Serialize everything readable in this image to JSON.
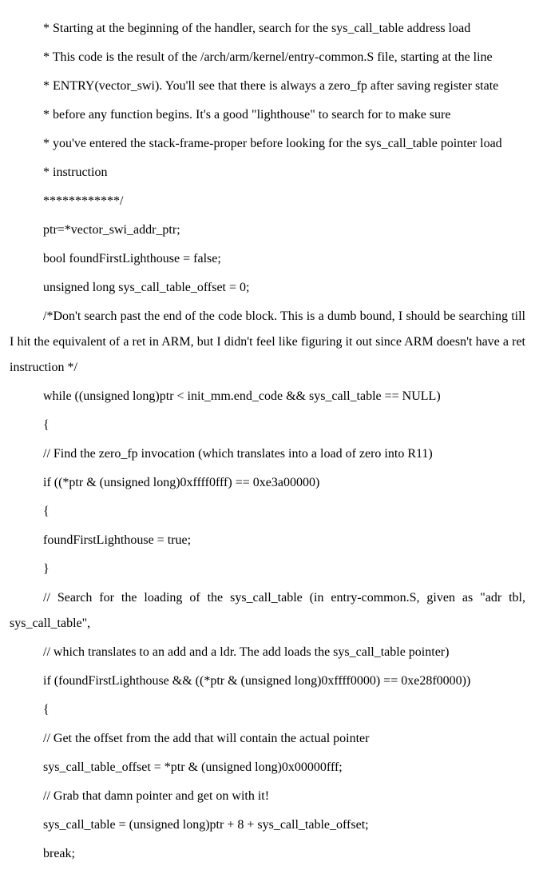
{
  "lines": {
    "l1": "* Starting at the beginning of the handler, search for the sys_call_table address load",
    "l2": "* This code is the result of the /arch/arm/kernel/entry-common.S file, starting at the line",
    "l3": "* ENTRY(vector_swi). You'll see that there is always a zero_fp after saving register state",
    "l4": "* before any function begins. It's a good \"lighthouse\" to search for to make sure",
    "l5": "* you've entered the stack-frame-proper before looking for the sys_call_table pointer load",
    "l6": "* instruction",
    "l7": "************/",
    "l8": "ptr=*vector_swi_addr_ptr;",
    "l9": "bool foundFirstLighthouse = false;",
    "l10": "unsigned long sys_call_table_offset = 0;",
    "l11": "/*Don't search past the end of the code block. This is a dumb bound, I should be searching till I hit the equivalent of a ret in ARM, but I didn't feel like figuring it out since ARM doesn't have a ret instruction */",
    "l12": "while ((unsigned long)ptr < init_mm.end_code && sys_call_table == NULL)",
    "l13": "{",
    "l14": "// Find the zero_fp invocation (which translates into a load of zero into R11)",
    "l15": "if ((*ptr & (unsigned long)0xffff0fff) == 0xe3a00000)",
    "l16": "{",
    "l17": "foundFirstLighthouse = true;",
    "l18": "}",
    "l19": "// Search for the loading of the sys_call_table (in entry-common.S, given as \"adr tbl, sys_call_table\",",
    "l20": "// which translates to an add and a ldr. The add loads the sys_call_table pointer)",
    "l21": "if (foundFirstLighthouse && ((*ptr & (unsigned long)0xffff0000) == 0xe28f0000))",
    "l22": "{",
    "l23": "// Get the offset from the add that will contain the actual pointer",
    "l24": "sys_call_table_offset = *ptr & (unsigned long)0x00000fff;",
    "l25": "// Grab that damn pointer and get on with it!",
    "l26": "sys_call_table = (unsigned long)ptr + 8 + sys_call_table_offset;",
    "l27": "break;"
  }
}
